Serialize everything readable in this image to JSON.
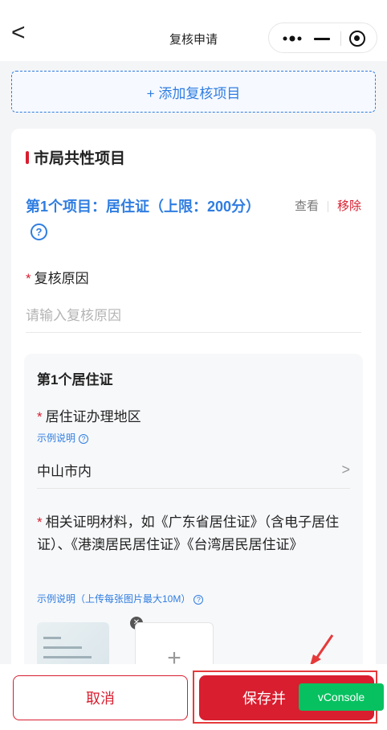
{
  "nav": {
    "back": "<",
    "title": "复核申请"
  },
  "add_button": "+ 添加复核项目",
  "section": {
    "title": "市局共性项目",
    "item_title": "第1个项目：居住证（上限：200分）",
    "view": "查看",
    "remove": "移除",
    "help": "?"
  },
  "reason": {
    "label": "复核原因",
    "placeholder": "请输入复核原因",
    "required": "*"
  },
  "permit": {
    "title": "第1个居住证",
    "area_label": "居住证办理地区",
    "area_hint": "示例说明",
    "area_value": "中山市内",
    "materials_label": "相关证明材料，如《广东省居住证》（含电子居住证）、《港澳居民居住证》《台湾居民居住证》",
    "materials_hint": "示例说明（上传每张图片最大10M）",
    "upload_plus": "+"
  },
  "bottom": {
    "cancel": "取消",
    "save": "保存并",
    "vconsole": "vConsole"
  },
  "colors": {
    "primary": "#2f7de1",
    "danger": "#d81e2f",
    "vconsole": "#07c160"
  }
}
